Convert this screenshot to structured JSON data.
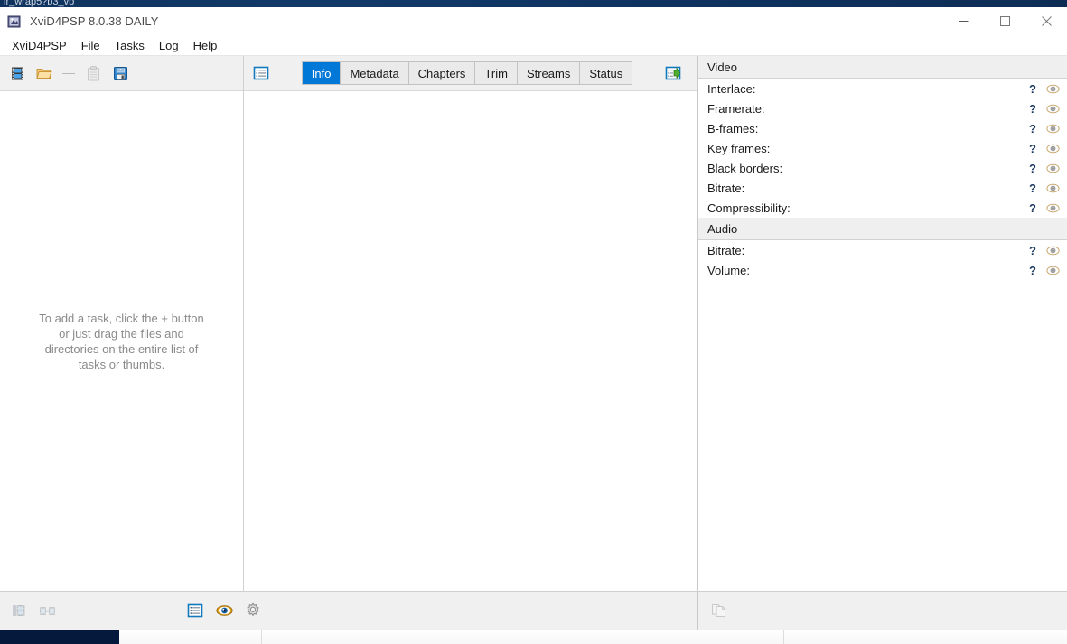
{
  "background": {
    "behind_window_title": "ir_wrap5?b3_vb",
    "taskbar_color": "#05193c"
  },
  "window": {
    "title": "XviD4PSP 8.0.38 DAILY",
    "icon": "app-icon",
    "controls": {
      "minimize": "—",
      "maximize": "☐",
      "close": "✕"
    }
  },
  "menubar": {
    "items": [
      {
        "label": "XviD4PSP",
        "name": "menu-xvid4psp"
      },
      {
        "label": "File",
        "name": "menu-file"
      },
      {
        "label": "Tasks",
        "name": "menu-tasks"
      },
      {
        "label": "Log",
        "name": "menu-log"
      },
      {
        "label": "Help",
        "name": "menu-help"
      }
    ]
  },
  "left_pane": {
    "toolbar": [
      {
        "name": "add-video-button",
        "icon": "film-strip-icon",
        "enabled": true
      },
      {
        "name": "open-folder-button",
        "icon": "folder-open-icon",
        "enabled": true
      },
      {
        "name": "toolbar-separator",
        "icon": "separator",
        "enabled": false
      },
      {
        "name": "paste-button",
        "icon": "clipboard-icon",
        "enabled": false
      },
      {
        "name": "save-button",
        "icon": "floppy-save-icon",
        "enabled": true
      }
    ],
    "empty_hint": "To add a task, click the + button\nor just drag the files and\ndirectories on the entire list of\ntasks or thumbs."
  },
  "center_pane": {
    "list_view_icon": "list-view-icon",
    "export_icon": "export-arrow-icon",
    "tabs": [
      {
        "label": "Info",
        "active": true
      },
      {
        "label": "Metadata",
        "active": false
      },
      {
        "label": "Chapters",
        "active": false
      },
      {
        "label": "Trim",
        "active": false
      },
      {
        "label": "Streams",
        "active": false
      },
      {
        "label": "Status",
        "active": false
      }
    ]
  },
  "right_pane": {
    "groups": [
      {
        "title": "Video",
        "rows": [
          {
            "label": "Interlace:",
            "value": "?"
          },
          {
            "label": "Framerate:",
            "value": "?"
          },
          {
            "label": "B-frames:",
            "value": "?"
          },
          {
            "label": "Key frames:",
            "value": "?"
          },
          {
            "label": "Black borders:",
            "value": "?"
          },
          {
            "label": "Bitrate:",
            "value": "?"
          },
          {
            "label": "Compressibility:",
            "value": "?"
          }
        ]
      },
      {
        "title": "Audio",
        "rows": [
          {
            "label": "Bitrate:",
            "value": "?"
          },
          {
            "label": "Volume:",
            "value": "?"
          }
        ]
      }
    ],
    "row_action_icon": "eye-icon"
  },
  "statusbar": {
    "left_buttons": [
      {
        "name": "thumbs-view-button",
        "icon": "film-stack-icon",
        "enabled": false
      },
      {
        "name": "chain-frames-button",
        "icon": "film-chain-icon",
        "enabled": false
      }
    ],
    "center_buttons": [
      {
        "name": "list-toggle-button",
        "icon": "list-view-icon",
        "enabled": true
      },
      {
        "name": "preview-toggle-button",
        "icon": "eye-icon",
        "enabled": true
      },
      {
        "name": "settings-button",
        "icon": "gear-icon",
        "enabled": true
      }
    ],
    "right_buttons": [
      {
        "name": "copy-settings-button",
        "icon": "copy-pages-icon",
        "enabled": false
      }
    ]
  },
  "colors": {
    "accent": "#0078d7",
    "toolbar_bg": "#f0f0f0",
    "group_header_bg": "#efefef",
    "value_text": "#17365d",
    "hint_text": "#8a8a8a"
  }
}
